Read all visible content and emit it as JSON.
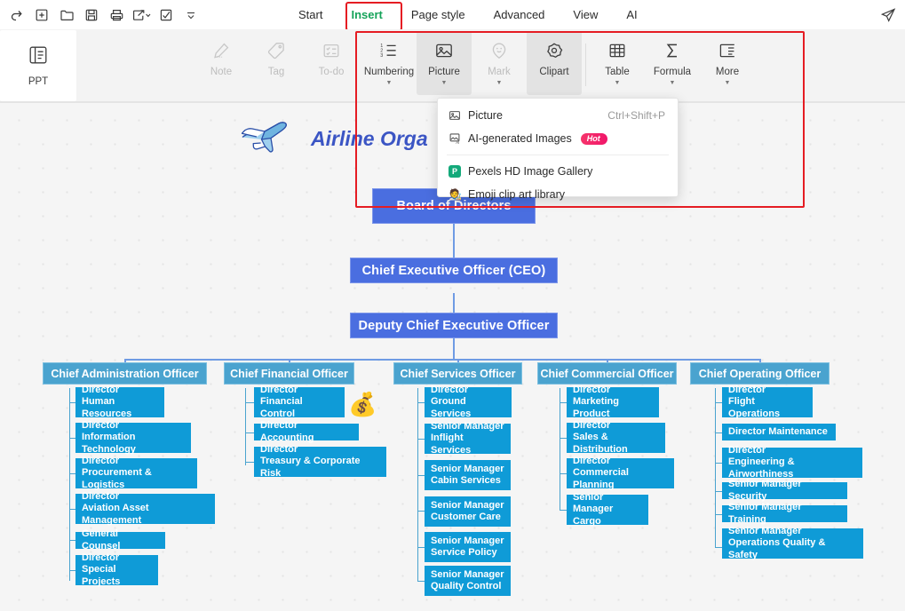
{
  "window": {
    "quick_access": [
      {
        "name": "redo-icon",
        "label": "Redo"
      },
      {
        "name": "new-icon",
        "label": "New"
      },
      {
        "name": "open-folder-icon",
        "label": "Open"
      },
      {
        "name": "save-icon",
        "label": "Save"
      },
      {
        "name": "print-icon",
        "label": "Print"
      },
      {
        "name": "share-export-icon",
        "label": "Export"
      },
      {
        "name": "select-icon",
        "label": "Select"
      },
      {
        "name": "more-chevron-icon",
        "label": "More"
      }
    ],
    "send_icon": "paper-plane-icon"
  },
  "menu": {
    "tabs": [
      {
        "label": "Start",
        "active": false
      },
      {
        "label": "Insert",
        "active": true
      },
      {
        "label": "Page style",
        "active": false
      },
      {
        "label": "Advanced",
        "active": false
      },
      {
        "label": "View",
        "active": false
      },
      {
        "label": "AI",
        "active": false
      }
    ],
    "active_tab": "Insert",
    "highlight_color": "#e51c23"
  },
  "ribbon": {
    "ppt_button": {
      "label": "PPT",
      "icon": "ppt-icon"
    },
    "buttons": [
      {
        "label": "Note",
        "icon": "pen-note-icon",
        "dimmed": true,
        "caret": false,
        "selected": false
      },
      {
        "label": "Tag",
        "icon": "tag-icon",
        "dimmed": true,
        "caret": false,
        "selected": false
      },
      {
        "label": "To-do",
        "icon": "todo-list-icon",
        "dimmed": true,
        "caret": false,
        "selected": false
      },
      {
        "label": "Numbering",
        "icon": "numbering-icon",
        "dimmed": false,
        "caret": true,
        "selected": false
      },
      {
        "label": "Picture",
        "icon": "picture-icon",
        "dimmed": false,
        "caret": true,
        "selected": true
      },
      {
        "label": "Mark",
        "icon": "mark-smiley-icon",
        "dimmed": true,
        "caret": true,
        "selected": false
      },
      {
        "label": "Clipart",
        "icon": "clipart-icon",
        "dimmed": false,
        "caret": false,
        "selected": true
      },
      {
        "label": "Table",
        "icon": "table-icon",
        "dimmed": false,
        "caret": true,
        "selected": false
      },
      {
        "label": "Formula",
        "icon": "sigma-formula-icon",
        "dimmed": false,
        "caret": true,
        "selected": false
      },
      {
        "label": "More",
        "icon": "more-panel-icon",
        "dimmed": false,
        "caret": true,
        "selected": false
      }
    ]
  },
  "picture_menu": {
    "items": [
      {
        "label": "Picture",
        "icon": "picture-icon",
        "shortcut": "Ctrl+Shift+P",
        "badge": null
      },
      {
        "label": "AI-generated Images",
        "icon": "ai-image-icon",
        "shortcut": "",
        "badge": "Hot"
      },
      {
        "label": "Pexels HD Image Gallery",
        "icon": "pexels-icon",
        "shortcut": "",
        "badge": null
      },
      {
        "label": "Emoji clip art library",
        "icon": "emoji-icon",
        "shortcut": "",
        "badge": null
      }
    ]
  },
  "chart_data": {
    "type": "diagram",
    "title": "Airline Orga",
    "title_full_visible": "Airline Orga",
    "title_color": "#3b55c4",
    "logo_icon": "airplane-icon",
    "colors": {
      "top_node": "#4a6ee0",
      "dept_node": "#4aa3cf",
      "sub_node": "#0f9bd7",
      "connector": "#8fb4ea",
      "canvas": "#f5f5f5"
    },
    "root": "Board of Directors",
    "chain": [
      "Board of Directors",
      "Chief Executive Officer (CEO)",
      "Deputy Chief Executive Officer"
    ],
    "departments": [
      {
        "head": "Chief Administration Officer",
        "reports": [
          {
            "line1": "Director",
            "line2": "Human Resources"
          },
          {
            "line1": "Director",
            "line2": "Information Technology"
          },
          {
            "line1": "Director",
            "line2": "Procurement & Logistics"
          },
          {
            "line1": "Director",
            "line2": "Aviation Asset Management"
          },
          {
            "line1": "General Counsel",
            "line2": ""
          },
          {
            "line1": "Director",
            "line2": "Special Projects"
          }
        ]
      },
      {
        "head": "Chief Financial Officer",
        "decoration": "money-bag-icon",
        "reports": [
          {
            "line1": "Director",
            "line2": "Financial Control"
          },
          {
            "line1": "Director Accounting",
            "line2": ""
          },
          {
            "line1": "Director",
            "line2": "Treasury & Corporate Risk"
          }
        ]
      },
      {
        "head": "Chief Services Officer",
        "reports": [
          {
            "line1": "Director",
            "line2": "Ground Services"
          },
          {
            "line1": "Senior Manager",
            "line2": "Inflight Services"
          },
          {
            "line1": "Senior Manager",
            "line2": "Cabin Services"
          },
          {
            "line1": "Senior Manager",
            "line2": "Customer Care"
          },
          {
            "line1": "Senior Manager",
            "line2": "Service Policy"
          },
          {
            "line1": "Senior Manager",
            "line2": "Quality Control"
          }
        ]
      },
      {
        "head": "Chief Commercial Officer",
        "reports": [
          {
            "line1": "Director",
            "line2": "Marketing Product"
          },
          {
            "line1": "Director",
            "line2": "Sales & Distribution"
          },
          {
            "line1": "Director",
            "line2": "Commercial Planning"
          },
          {
            "line1": "Senior Manager",
            "line2": "Cargo"
          }
        ]
      },
      {
        "head": "Chief Operating Officer",
        "reports": [
          {
            "line1": "Director",
            "line2": "Flight Operations"
          },
          {
            "line1": "Director Maintenance",
            "line2": ""
          },
          {
            "line1": "Director",
            "line2": "Engineering & Airworthiness"
          },
          {
            "line1": "Senior Manager Security",
            "line2": ""
          },
          {
            "line1": "Senior Manager Training",
            "line2": ""
          },
          {
            "line1": "Senior Manager",
            "line2": "Operations Quality & Safety"
          }
        ]
      }
    ]
  }
}
